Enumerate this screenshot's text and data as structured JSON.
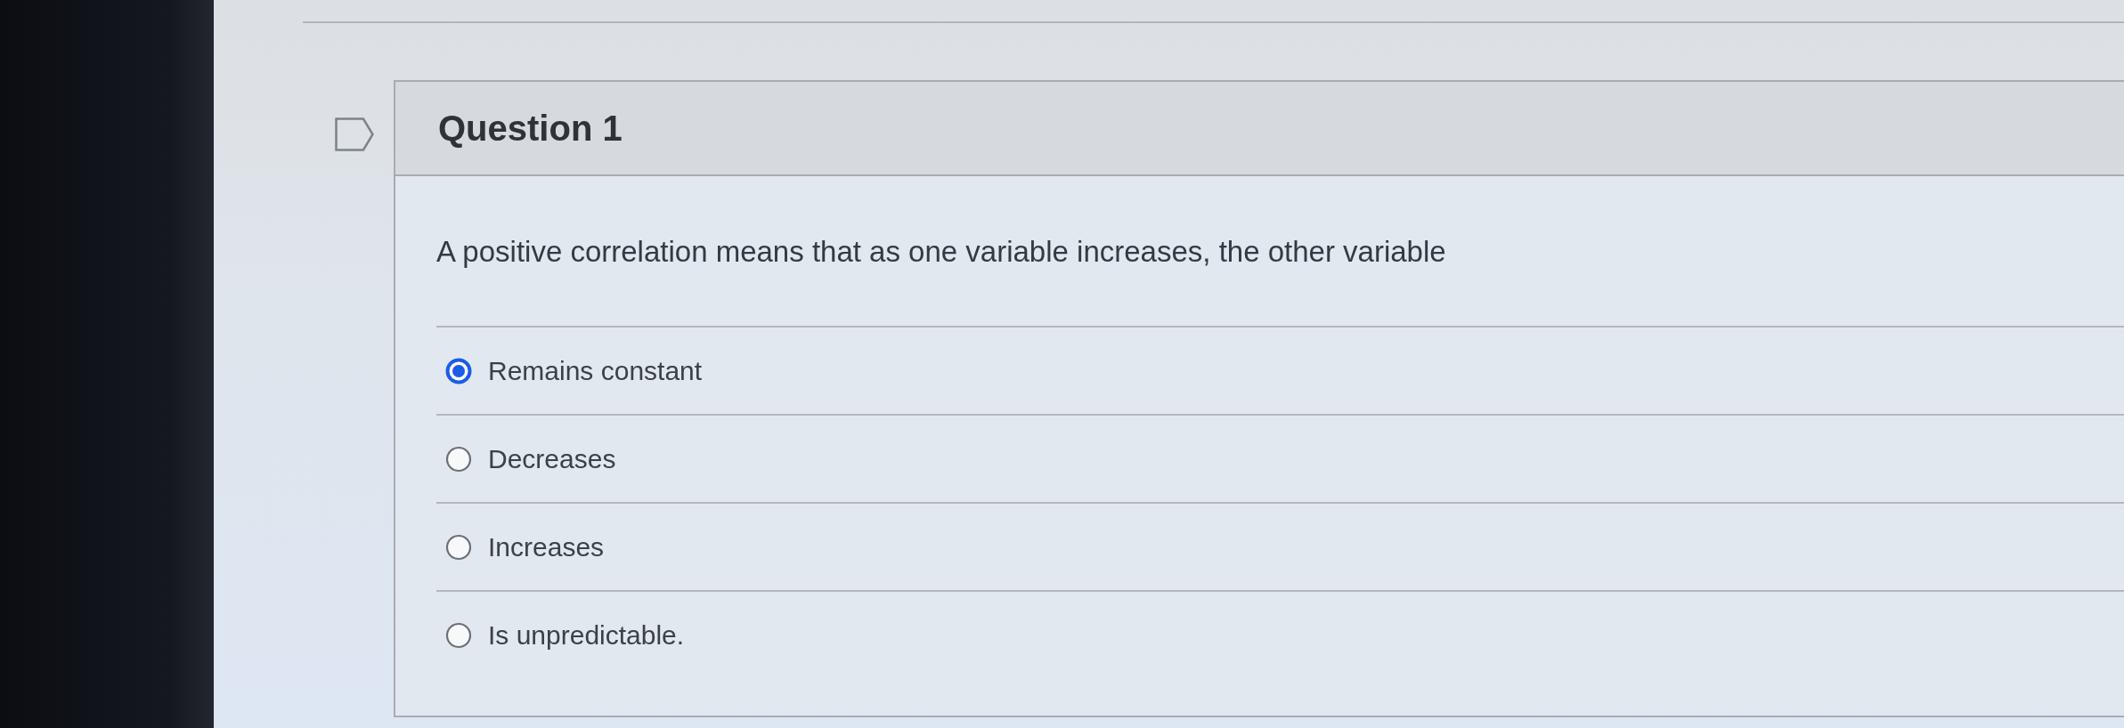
{
  "question": {
    "title": "Question 1",
    "text": "A positive correlation means that as one variable increases, the other variable"
  },
  "answers": [
    {
      "label": "Remains constant",
      "selected": true
    },
    {
      "label": "Decreases",
      "selected": false
    },
    {
      "label": "Increases",
      "selected": false
    },
    {
      "label": "Is unpredictable.",
      "selected": false
    }
  ]
}
